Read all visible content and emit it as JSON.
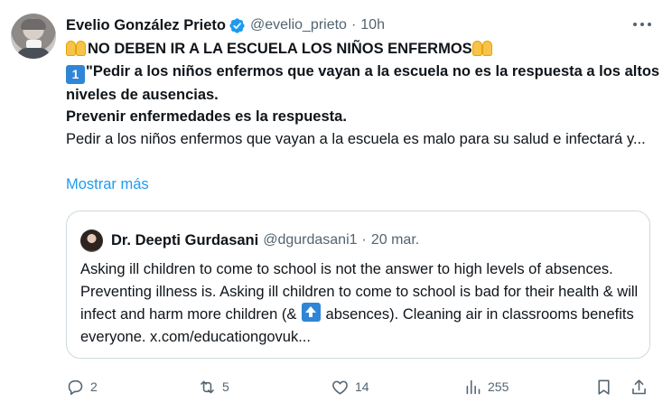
{
  "author": {
    "name": "Evelio González Prieto",
    "handle": "@evelio_prieto",
    "separator": "·",
    "time": "10h",
    "verified_color": "#1d9bf0"
  },
  "post": {
    "headline": "NO DEBEN IR A LA ESCUELA LOS NIÑOS ENFERMOS",
    "number_emoji": "1",
    "bold_text": "\"Pedir a los niños enfermos que vayan a la escuela no es la respuesta a los altos niveles de ausencias.",
    "bold_text_2": "Prevenir enfermedades es la respuesta.",
    "body_text": "Pedir a los niños enfermos que vayan a la escuela es malo para su salud e infectará y...",
    "show_more": "Mostrar más"
  },
  "quote": {
    "name": "Dr. Deepti Gurdasani",
    "handle": "@dgurdasani1",
    "separator": "·",
    "date": "20 mar.",
    "text_before": "Asking ill children to come to school is not the answer to high levels of absences. Preventing illness is. Asking ill children to come to school is bad for their health & will infect and harm more children (&",
    "text_after": "absences). Cleaning air in classrooms benefits everyone. x.com/educationgovuk..."
  },
  "actions": {
    "reply_count": "2",
    "repost_count": "5",
    "like_count": "14",
    "views_count": "255"
  },
  "icons": [
    "verified-icon",
    "more-icon",
    "reply-icon",
    "repost-icon",
    "like-icon",
    "views-icon",
    "bookmark-icon",
    "share-icon"
  ],
  "colors": {
    "link": "#1d9bf0",
    "muted": "#536471",
    "border": "#cfd9de",
    "text": "#0f1419"
  }
}
